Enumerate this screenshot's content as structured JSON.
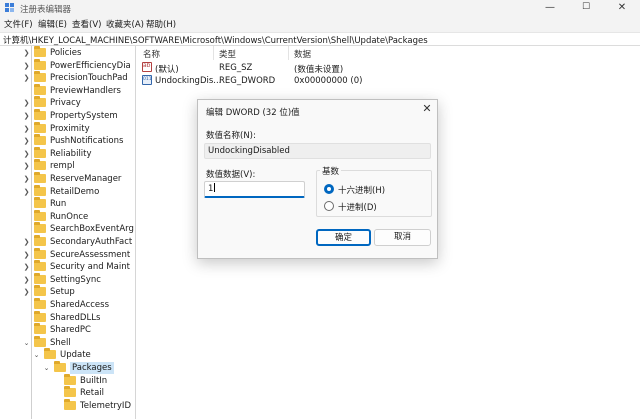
{
  "window": {
    "title": "注册表编辑器",
    "icon": "registry-editor-icon",
    "controls": {
      "minimize": "—",
      "maximize": "☐",
      "close": "✕"
    }
  },
  "menu": [
    "文件(F)",
    "编辑(E)",
    "查看(V)",
    "收藏夹(A)",
    "帮助(H)"
  ],
  "address": "计算机\\HKEY_LOCAL_MACHINE\\SOFTWARE\\Microsoft\\Windows\\CurrentVersion\\Shell\\Update\\Packages",
  "tree": [
    {
      "label": "Policies",
      "expander": "❯"
    },
    {
      "label": "PowerEfficiencyDia",
      "expander": "❯"
    },
    {
      "label": "PrecisionTouchPad",
      "expander": "❯"
    },
    {
      "label": "PreviewHandlers",
      "expander": ""
    },
    {
      "label": "Privacy",
      "expander": "❯"
    },
    {
      "label": "PropertySystem",
      "expander": "❯"
    },
    {
      "label": "Proximity",
      "expander": "❯"
    },
    {
      "label": "PushNotifications",
      "expander": "❯"
    },
    {
      "label": "Reliability",
      "expander": "❯"
    },
    {
      "label": "rempl",
      "expander": "❯"
    },
    {
      "label": "ReserveManager",
      "expander": "❯"
    },
    {
      "label": "RetailDemo",
      "expander": "❯"
    },
    {
      "label": "Run",
      "expander": ""
    },
    {
      "label": "RunOnce",
      "expander": ""
    },
    {
      "label": "SearchBoxEventArg",
      "expander": ""
    },
    {
      "label": "SecondaryAuthFact",
      "expander": "❯"
    },
    {
      "label": "SecureAssessment",
      "expander": "❯"
    },
    {
      "label": "Security and Maint",
      "expander": "❯"
    },
    {
      "label": "SettingSync",
      "expander": "❯"
    },
    {
      "label": "Setup",
      "expander": "❯"
    },
    {
      "label": "SharedAccess",
      "expander": ""
    },
    {
      "label": "SharedDLLs",
      "expander": ""
    },
    {
      "label": "SharedPC",
      "expander": ""
    },
    {
      "label": "Shell",
      "expander": "⌄"
    },
    {
      "label": "Update",
      "expander": "⌄"
    },
    {
      "label": "Packages",
      "expander": "⌄"
    },
    {
      "label": "BuiltIn",
      "expander": ""
    },
    {
      "label": "Retail",
      "expander": ""
    },
    {
      "label": "TelemetryID",
      "expander": ""
    }
  ],
  "list": {
    "columns": {
      "name": "名称",
      "type": "类型",
      "data": "数据"
    },
    "rows": [
      {
        "name": "(默认)",
        "type": "REG_SZ",
        "data": "(数值未设置)",
        "icon": "string-value-icon"
      },
      {
        "name": "UndockingDis...",
        "type": "REG_DWORD",
        "data": "0x00000000 (0)",
        "icon": "dword-value-icon"
      }
    ]
  },
  "dialog": {
    "title": "编辑 DWORD (32 位)值",
    "close": "✕",
    "name_label": "数值名称(N):",
    "name_value": "UndockingDisabled",
    "data_label": "数值数据(V):",
    "data_value": "1",
    "base_label": "基数",
    "radio_hex": "十六进制(H)",
    "radio_dec": "十进制(D)",
    "ok": "确定",
    "cancel": "取消"
  },
  "colors": {
    "accent": "#0067c0",
    "selection": "#cce4f7",
    "folder": "#f4c54a"
  }
}
